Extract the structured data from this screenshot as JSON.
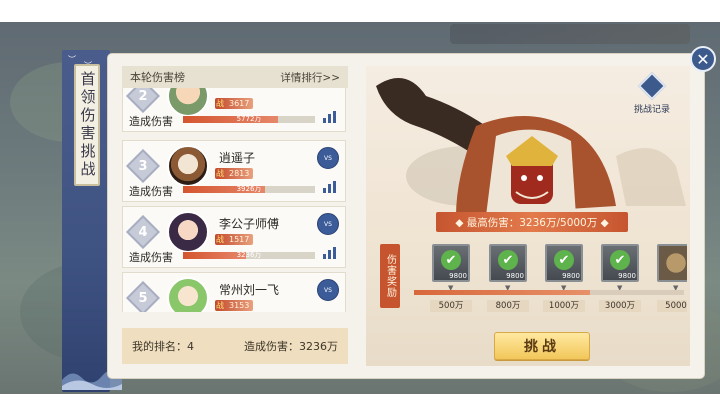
{
  "banner": {
    "title": "首领伤害挑战"
  },
  "damage_board": {
    "title": "本轮伤害榜",
    "detail_link": "详情排行>>",
    "damage_label": "造成伤害",
    "rows": [
      {
        "rank": "2",
        "name": "",
        "power": "3617",
        "damage": "5772万",
        "fill": 0.72
      },
      {
        "rank": "3",
        "name": "逍遥子",
        "power": "2813",
        "damage": "3926万",
        "fill": 0.62
      },
      {
        "rank": "4",
        "name": "李公子师傅",
        "power": "1517",
        "damage": "3236万",
        "fill": 0.48
      },
      {
        "rank": "5",
        "name": "常州刘一飞",
        "power": "3153",
        "damage": "",
        "fill": 0.0
      }
    ]
  },
  "my_rank": {
    "rank_text": "我的排名：4",
    "damage_text": "造成伤害：3236万"
  },
  "boss": {
    "record_label": "挑战记录",
    "highest_damage": "◆ 最高伤害：3236万/5000万 ◆",
    "reward_label": "伤害奖励",
    "progress": 0.65,
    "rewards": [
      {
        "qty": "9800",
        "threshold": "500万",
        "claimed": true
      },
      {
        "qty": "9800",
        "threshold": "800万",
        "claimed": true
      },
      {
        "qty": "9800",
        "threshold": "1000万",
        "claimed": true
      },
      {
        "qty": "9800",
        "threshold": "3000万",
        "claimed": true
      },
      {
        "qty": "",
        "threshold": "5000",
        "claimed": false
      }
    ]
  },
  "challenge_button": "挑战",
  "close_icon": "close-icon",
  "colors": {
    "accent": "#3c5a8c",
    "damage_bar": "#d4552f",
    "button_gold": "#f2c75a"
  }
}
